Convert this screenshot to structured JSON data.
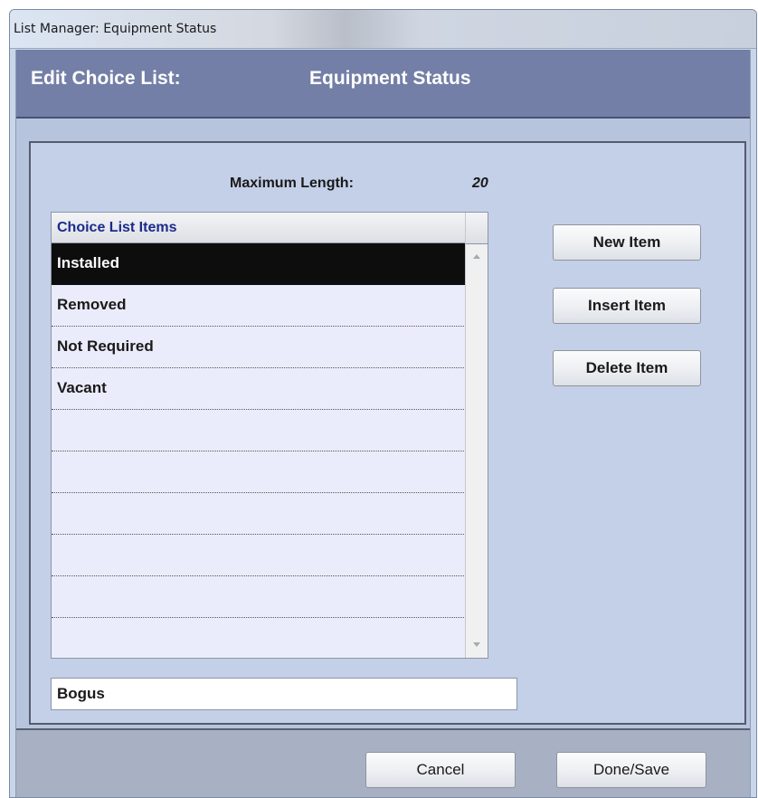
{
  "window": {
    "title": "List Manager: Equipment Status"
  },
  "header": {
    "label": "Edit Choice List:",
    "list_name": "Equipment Status"
  },
  "max_length": {
    "label": "Maximum Length:",
    "value": "20"
  },
  "list": {
    "column_header": "Choice List Items",
    "items": [
      {
        "label": "Installed",
        "selected": true
      },
      {
        "label": "Removed",
        "selected": false
      },
      {
        "label": "Not Required",
        "selected": false
      },
      {
        "label": "Vacant",
        "selected": false
      },
      {
        "label": "",
        "selected": false
      },
      {
        "label": "",
        "selected": false
      },
      {
        "label": "",
        "selected": false
      },
      {
        "label": "",
        "selected": false
      },
      {
        "label": "",
        "selected": false
      },
      {
        "label": "",
        "selected": false
      }
    ]
  },
  "entry_field": {
    "value": "Bogus"
  },
  "buttons": {
    "new_item": "New Item",
    "insert_item": "Insert Item",
    "delete_item": "Delete Item",
    "cancel": "Cancel",
    "done_save": "Done/Save"
  },
  "icons": {
    "scroll_up": "scroll-up-arrow-icon",
    "scroll_down": "scroll-down-arrow-icon"
  },
  "colors": {
    "header_band": "#747fa7",
    "content_bg": "#c4d0e8",
    "list_bg": "#ebecfb",
    "selected_row": "#0d0d0d",
    "column_header_text": "#1b2a8c"
  }
}
